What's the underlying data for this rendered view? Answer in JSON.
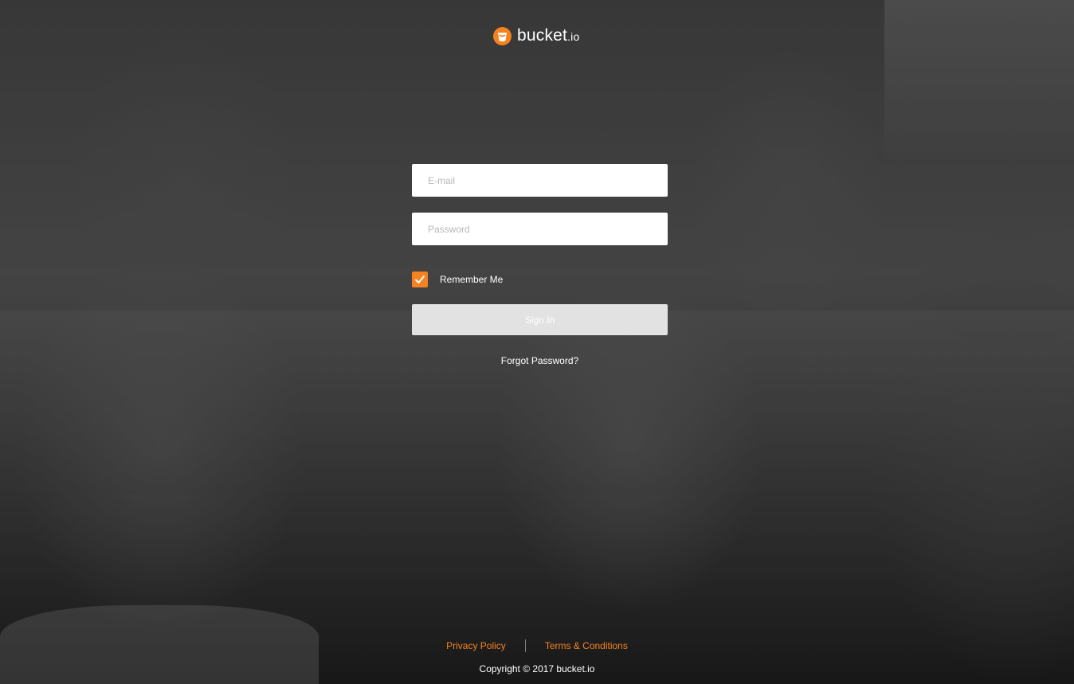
{
  "brand": {
    "name": "bucket",
    "tld": ".io",
    "accent_color": "#f58220",
    "icon": "bucket-logo-icon"
  },
  "login": {
    "email_placeholder": "E-mail",
    "email_value": "",
    "password_placeholder": "Password",
    "password_value": "",
    "remember_label": "Remember Me",
    "remember_checked": true,
    "signin_label": "Sign In",
    "forgot_label": "Forgot Password?"
  },
  "footer": {
    "privacy_label": "Privacy Policy",
    "terms_label": "Terms & Conditions",
    "copyright": "Copyright © 2017 bucket.io"
  }
}
